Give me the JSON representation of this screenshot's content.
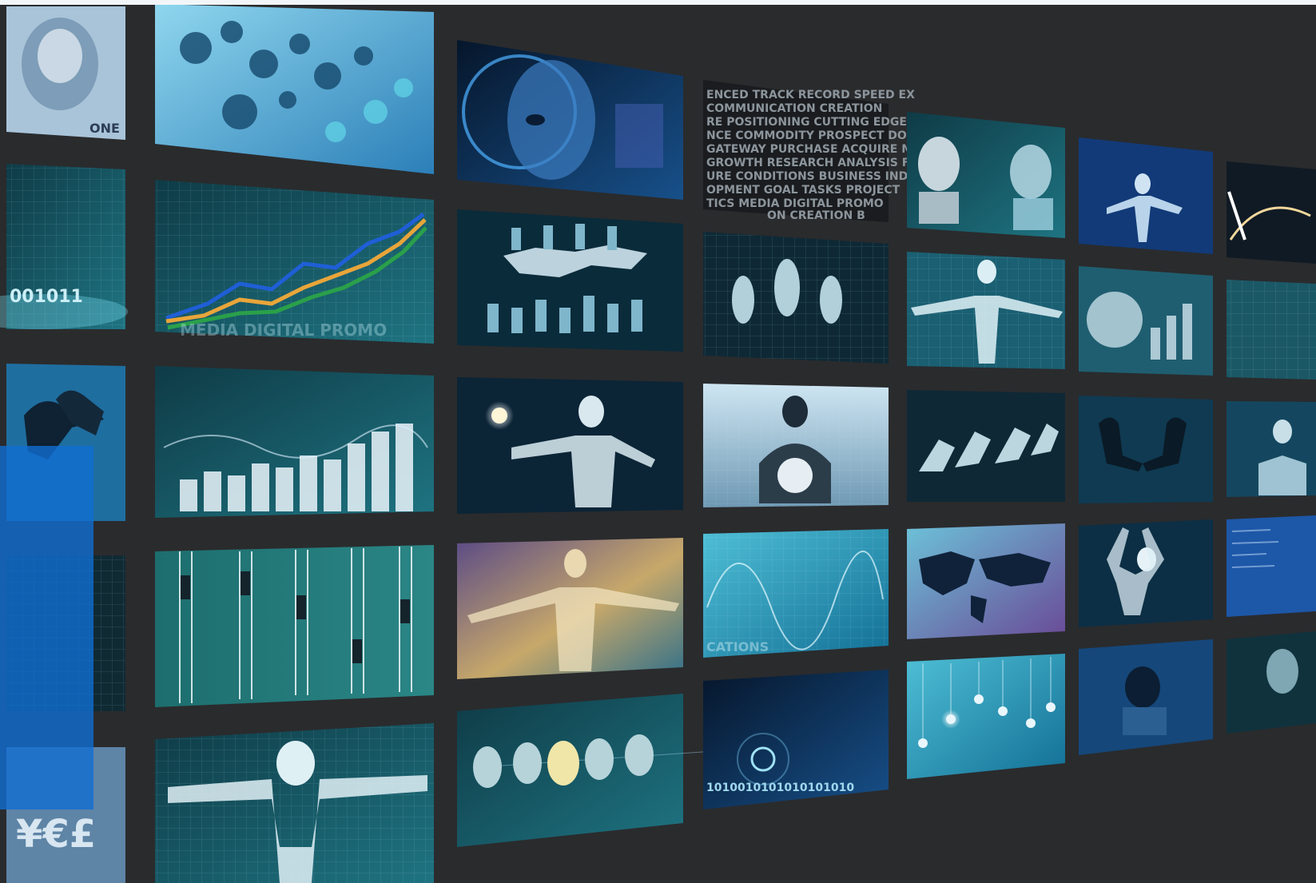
{
  "colors": {
    "background": "#2a2b2d",
    "overlay": "#106ed2",
    "teal": "#1d6e7a",
    "navy": "#0d2a4a",
    "cyan": "#3fc6e0"
  },
  "texts": {
    "binary_left": "001011",
    "binary_bottom": "1010010101010101010",
    "banknote": "ONE",
    "wordcloud_lines": [
      "ENCED TRACK RECORD SPEED EX",
      "COMMUNICATION CREATION",
      "RE POSITIONING CUTTING EDGE",
      "NCE COMMODITY PROSPECT DOCUME",
      "GATEWAY PURCHASE ACQUIRE MER",
      "GROWTH RESEARCH ANALYSIS FO",
      "URE CONDITIONS BUSINESS IND",
      "OPMENT GOAL TASKS PROJECT",
      "TICS MEDIA DIGITAL PROMO",
      "ON CREATION B"
    ],
    "chart_tile_text": "MEDIA DIGITAL PROMO",
    "chart_tile_text2": "ON CREATION",
    "wave_tile_text": "CATIONS"
  }
}
